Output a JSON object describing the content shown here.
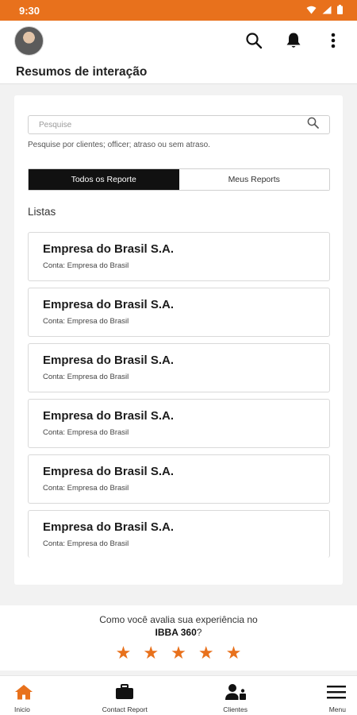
{
  "status_bar": {
    "time": "9:30"
  },
  "page": {
    "title": "Resumos de interação"
  },
  "search": {
    "placeholder": "Pesquise",
    "value": "",
    "hint": "Pesquise por clientes; officer; atraso ou sem atraso."
  },
  "tabs": [
    {
      "label": "Todos os Reporte",
      "active": true
    },
    {
      "label": "Meus Reports",
      "active": false
    }
  ],
  "section_label": "Listas",
  "list_items": [
    {
      "title": "Empresa do Brasil S.A.",
      "subtitle": "Conta: Empresa do Brasil"
    },
    {
      "title": "Empresa do Brasil S.A.",
      "subtitle": "Conta: Empresa do Brasil"
    },
    {
      "title": "Empresa do Brasil S.A.",
      "subtitle": "Conta: Empresa do Brasil"
    },
    {
      "title": "Empresa do Brasil S.A.",
      "subtitle": "Conta: Empresa do Brasil"
    },
    {
      "title": "Empresa do Brasil S.A.",
      "subtitle": "Conta: Empresa do Brasil"
    },
    {
      "title": "Empresa do Brasil S.A.",
      "subtitle": "Conta: Empresa do Brasil"
    }
  ],
  "rating": {
    "question": "Como você avalia sua experiência no",
    "app_name": "IBBA 360",
    "question_end": "?",
    "stars": 5
  },
  "bottom_nav": [
    {
      "label": "Inicio",
      "icon": "home-icon"
    },
    {
      "label": "Contact Report",
      "icon": "briefcase-icon"
    },
    {
      "label": "Clientes",
      "icon": "clients-icon"
    },
    {
      "label": "Menu",
      "icon": "hamburger-menu-icon"
    }
  ],
  "colors": {
    "accent": "#e8711c",
    "active_tab": "#111111",
    "background": "#f2f2f2"
  }
}
